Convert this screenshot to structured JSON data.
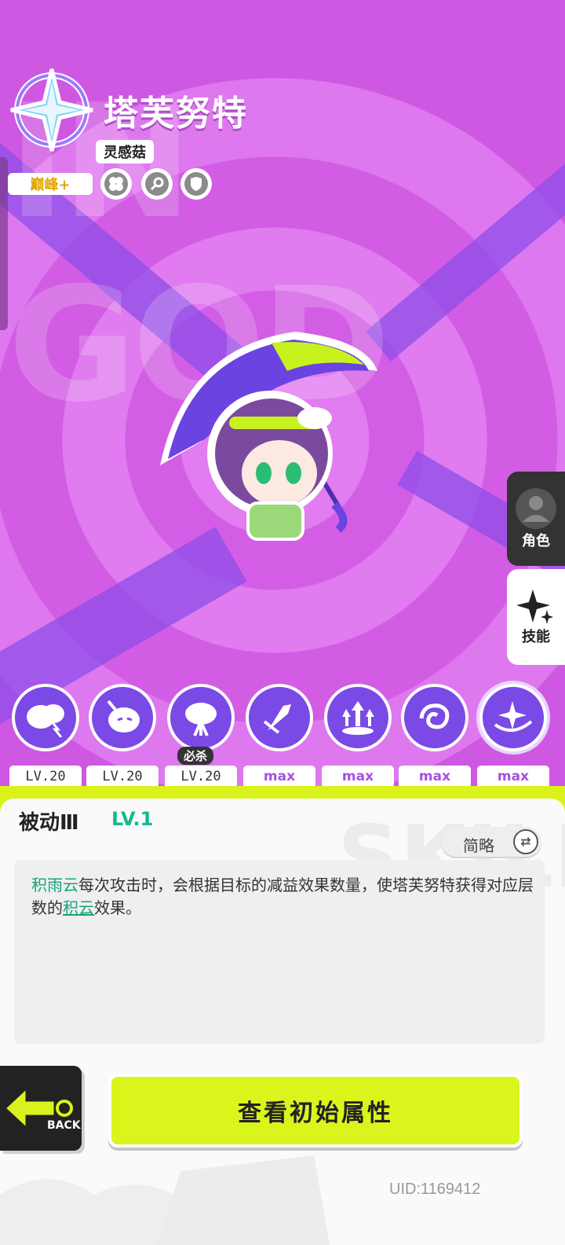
{
  "character": {
    "name": "塔芙努特",
    "tag": "灵感菇",
    "rank": "巅峰+",
    "background_word": "IN GOD",
    "trait_icons": [
      "clover-icon",
      "magnifier-icon",
      "shield-icon"
    ]
  },
  "side_nav": {
    "role_label": "角色",
    "skill_label": "技能"
  },
  "skills": [
    {
      "icon": "storm-cloud-icon",
      "level": "LV.20",
      "max": false
    },
    {
      "icon": "angry-cloud-icon",
      "level": "LV.20",
      "max": false
    },
    {
      "icon": "cloud-burst-icon",
      "level": "LV.20",
      "max": false,
      "badge": "必杀"
    },
    {
      "icon": "arrow-slash-icon",
      "level": "max",
      "max": true
    },
    {
      "icon": "triple-arrow-icon",
      "level": "max",
      "max": true
    },
    {
      "icon": "vortex-icon",
      "level": "max",
      "max": true
    },
    {
      "icon": "sparkle-swirl-icon",
      "level": "max",
      "max": true
    }
  ],
  "detail": {
    "title": "被动Ⅲ",
    "level": "LV.1",
    "brief_label": "简略",
    "background_word": "SKILL",
    "desc_kw1": "积雨云",
    "desc_part1": "每次攻击时，会根据目标的减益效果数量，使塔芙努特获得对应层数的",
    "desc_kw2": "积云",
    "desc_part2": "效果。"
  },
  "actions": {
    "back_label": "BACK",
    "main_button": "查看初始属性"
  },
  "footer": {
    "uid": "UID:1169412"
  },
  "colors": {
    "bg_magenta": "#d35ee5",
    "accent_green": "#d9f21b",
    "keyword_green": "#13a37d",
    "skill_purple": "#7a49e6"
  }
}
